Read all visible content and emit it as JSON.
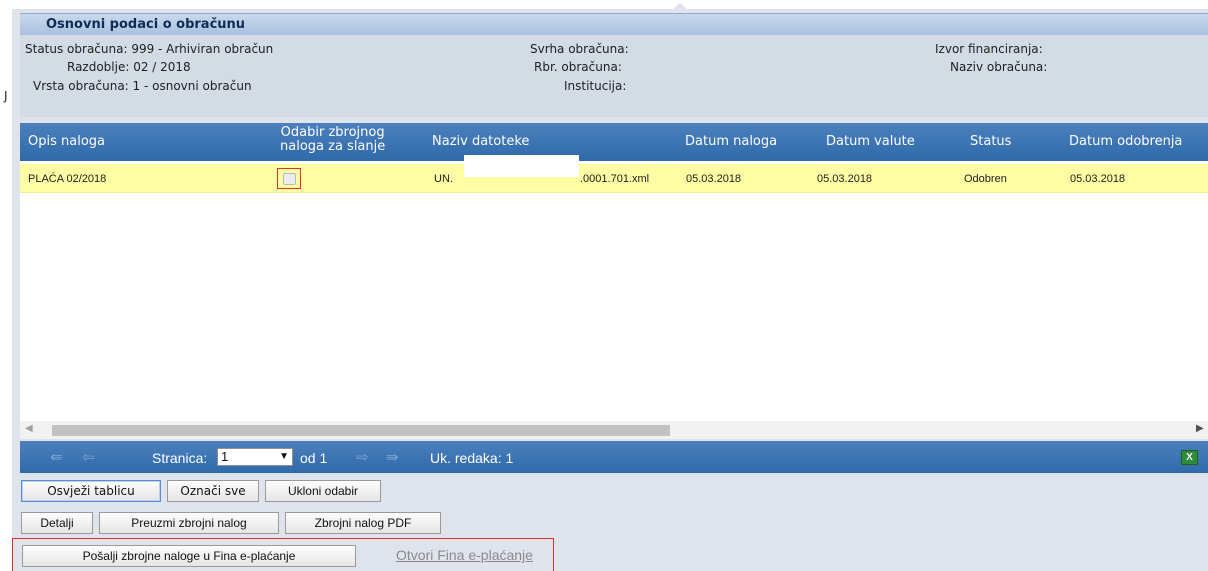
{
  "section": {
    "title": "Osnovni podaci o obračunu"
  },
  "info": {
    "status": "Status obračuna: 999 - Arhiviran obračun",
    "razdoblje": "Razdoblje: 02 / 2018",
    "vrsta": "Vrsta obračuna: 1 - osnovni obračun",
    "svrha": "Svrha obračuna:",
    "rbr": "Rbr. obračuna:",
    "institucija": "Institucija:",
    "izvor": "Izvor financiranja:",
    "naziv": "Naziv obračuna:",
    "left_marker": "J"
  },
  "grid": {
    "columns": {
      "opis": "Opis naloga",
      "odabir_1": "Odabir zbrojnog",
      "odabir_2": "naloga za slanje",
      "naziv": "Naziv datoteke",
      "datum_naloga": "Datum naloga",
      "datum_valute": "Datum valute",
      "status": "Status",
      "datum_odobrenja": "Datum odobrenja"
    },
    "rows": [
      {
        "opis": "PLAĆA 02/2018",
        "checked": false,
        "naziv_prefix": "UN.",
        "naziv_suffix": ".0001.701.xml",
        "datum_naloga": "05.03.2018",
        "datum_valute": "05.03.2018",
        "status": "Odobren",
        "datum_odobrenja": "05.03.2018"
      }
    ]
  },
  "pager": {
    "page_label": "Stranica:",
    "page_value": "1",
    "of_label": "od 1",
    "total_label": "Uk. redaka: 1",
    "excel_glyph": "X"
  },
  "buttons": {
    "refresh": "Osvježi tablicu",
    "select_all": "Označi sve",
    "deselect": "Ukloni odabir",
    "details": "Detalji",
    "download": "Preuzmi zbrojni nalog",
    "pdf": "Zbrojni nalog PDF",
    "send": "Pošalji zbrojne naloge u Fina e-plaćanje",
    "open_fina": "Otvori Fina e-plaćanje"
  },
  "icons": {
    "first": "⇚",
    "prev": "⇦",
    "next": "⇨",
    "last": "⇛",
    "scroll_left": "◀",
    "scroll_right": "▶",
    "caret": "▼"
  },
  "colors": {
    "header_blue": "#2f6aaa",
    "row_highlight": "#fdfda3",
    "highlight_border": "#e4302a"
  }
}
